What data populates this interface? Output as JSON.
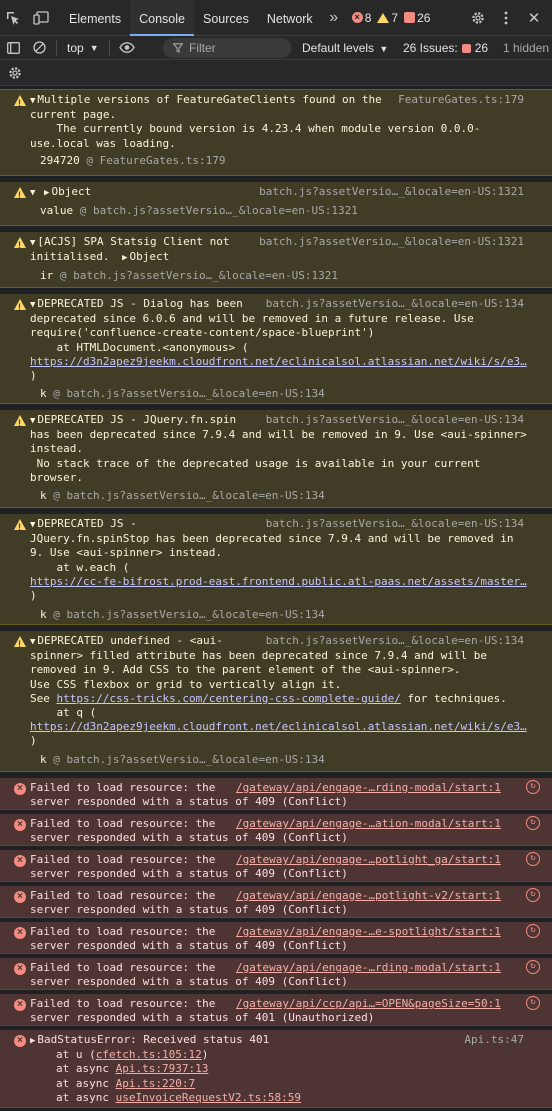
{
  "tabs": [
    {
      "label": "Elements"
    },
    {
      "label": "Console"
    },
    {
      "label": "Sources"
    },
    {
      "label": "Network"
    }
  ],
  "counts": {
    "errors": "8",
    "warnings": "7",
    "issues": "26"
  },
  "toolbar": {
    "context": "top",
    "filter_placeholder": "Filter",
    "levels": "Default levels",
    "issues_label": "26 Issues:",
    "issues_count": "26",
    "hidden": "1 hidden"
  },
  "messages": {
    "m1": {
      "l1": "Multiple versions of FeatureGateClients found on the",
      "src": "FeatureGates.ts:179",
      "l2": "current page.",
      "l3": "    The currently bound version is 4.23.4 when module version 0.0.0-",
      "l4": "use.local was loading.",
      "t1_num": "294720",
      "t1_link": "FeatureGates.ts:179"
    },
    "m2": {
      "l1": "Object",
      "src": "batch.js?assetVersio…_&locale=en-US:1321",
      "t_fn": "value",
      "t_link": "batch.js?assetVersio…_&locale=en-US:1321"
    },
    "m3": {
      "l1": "[ACJS] SPA Statsig Client not",
      "src": "batch.js?assetVersio…_&locale=en-US:1321",
      "l2": "initialised.",
      "obj": "Object",
      "t_fn": "ir",
      "t_link": "batch.js?assetVersio…_&locale=en-US:1321"
    },
    "m4": {
      "l1": "DEPRECATED JS - Dialog has been",
      "src": "batch.js?assetVersio…_&locale=en-US:134",
      "l2": "deprecated since 6.0.6 and will be removed in a future release. Use",
      "l3": "require('confluence-create-content/space-blueprint')",
      "l4": "    at HTMLDocument.<anonymous> (",
      "url": "https://d3n2apez9jeekm.cloudfront.net/eclinicalsol.atlassian.net/wiki/s/e3…",
      "l5": ")",
      "t_fn": "k",
      "t_link": "batch.js?assetVersio…_&locale=en-US:134"
    },
    "m5": {
      "l1": "DEPRECATED JS - JQuery.fn.spin",
      "src": "batch.js?assetVersio…_&locale=en-US:134",
      "l2": "has been deprecated since 7.9.4 and will be removed in 9. Use <aui-spinner>",
      "l3": "instead.",
      "l4": " No stack trace of the deprecated usage is available in your current",
      "l5": "browser.",
      "t_fn": "k",
      "t_link": "batch.js?assetVersio…_&locale=en-US:134"
    },
    "m6": {
      "l1": "DEPRECATED JS -",
      "src": "batch.js?assetVersio…_&locale=en-US:134",
      "l2": "JQuery.fn.spinStop has been deprecated since 7.9.4 and will be removed in",
      "l3": "9. Use <aui-spinner> instead.",
      "l4": "    at w.each (",
      "url": "https://cc-fe-bifrost.prod-east.frontend.public.atl-paas.net/assets/master…",
      "l5": ")",
      "t_fn": "k",
      "t_link": "batch.js?assetVersio…_&locale=en-US:134"
    },
    "m7": {
      "l1": "DEPRECATED undefined - <aui-",
      "src": "batch.js?assetVersio…_&locale=en-US:134",
      "l2": "spinner> filled attribute has been deprecated since 7.9.4 and will be",
      "l3": "removed in 9. Add CSS to the parent element of the <aui-spinner>.",
      "l4": "Use CSS flexbox or grid to vertically align it.",
      "l5a": "See ",
      "l5url": "https://css-tricks.com/centering-css-complete-guide/",
      "l5b": " for techniques.",
      "l6": "    at q (",
      "url": "https://d3n2apez9jeekm.cloudfront.net/eclinicalsol.atlassian.net/wiki/s/e3…",
      "l7": ")",
      "t_fn": "k",
      "t_link": "batch.js?assetVersio…_&locale=en-US:134"
    }
  },
  "errors": [
    {
      "l1": "Failed to load resource: the",
      "link": "/gateway/api/engage-…rding-modal/start:1",
      "l2": "server responded with a status of 409 (Conflict)"
    },
    {
      "l1": "Failed to load resource: the",
      "link": "/gateway/api/engage-…ation-modal/start:1",
      "l2": "server responded with a status of 409 (Conflict)"
    },
    {
      "l1": "Failed to load resource: the",
      "link": "/gateway/api/engage-…potlight_ga/start:1",
      "l2": "server responded with a status of 409 (Conflict)"
    },
    {
      "l1": "Failed to load resource: the",
      "link": "/gateway/api/engage-…potlight-v2/start:1",
      "l2": "server responded with a status of 409 (Conflict)"
    },
    {
      "l1": "Failed to load resource: the",
      "link": "/gateway/api/engage-…e-spotlight/start:1",
      "l2": "server responded with a status of 409 (Conflict)"
    },
    {
      "l1": "Failed to load resource: the",
      "link": "/gateway/api/engage-…rding-modal/start:1",
      "l2": "server responded with a status of 409 (Conflict)"
    },
    {
      "l1": "Failed to load resource: the",
      "link": "/gateway/api/ccp/api…=OPEN&pageSize=50:1",
      "l2": "server responded with a status of 401 (Unauthorized)"
    }
  ],
  "bad_status": {
    "l1": "BadStatusError: Received status 401",
    "src": "Api.ts:47",
    "at1": "at u (",
    "at1_link": "cfetch.ts:105:12",
    "at1_end": ")",
    "at2": "at async ",
    "at2_link": "Api.ts:7937:13",
    "at3": "at async ",
    "at3_link": "Api.ts:220:7",
    "at4": "at async ",
    "at4_link": "useInvoiceRequestV2.ts:58:59"
  }
}
